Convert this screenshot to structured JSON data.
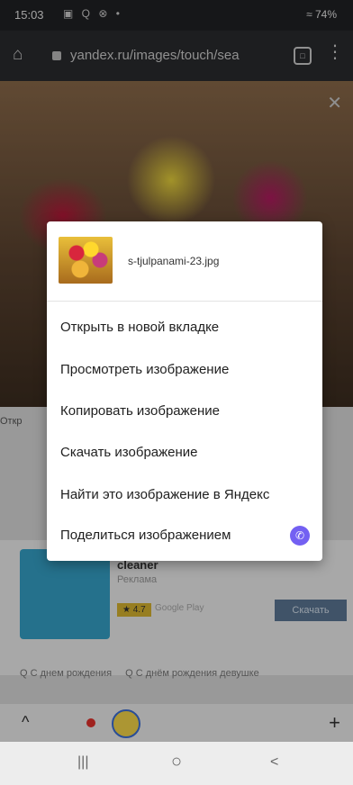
{
  "status_bar": {
    "time": "15:03",
    "icons": "▣ Q ⊗ •",
    "right": "≈ 74%"
  },
  "browser": {
    "url": "yandex.ru/images/touch/sea",
    "tabs_count": "□"
  },
  "background": {
    "close_glyph": "✕",
    "partial_text": "Откр",
    "app": {
      "name": "cleaner",
      "sub": "Реклама",
      "rating": "★ 4.7",
      "store": "Google Play",
      "install": "Скачать"
    },
    "chips": [
      "Q С днем рождения",
      "Q С днём рождения девушке"
    ]
  },
  "context_menu": {
    "filename": "s-tjulpanami-23.jpg",
    "items": [
      "Открыть в новой вкладке",
      "Просмотреть изображение",
      "Копировать изображение",
      "Скачать изображение",
      "Найти это изображение в Яндекс",
      "Поделиться изображением"
    ],
    "share_icon": "viber-icon"
  },
  "bottom_bar": {
    "up": "^",
    "plus": "+"
  },
  "nav_bar": {
    "recents": "|||",
    "home": "○",
    "back": "<"
  },
  "colors": {
    "accent": "#7360f2",
    "scrim": "rgba(0,0,0,0.30)"
  }
}
